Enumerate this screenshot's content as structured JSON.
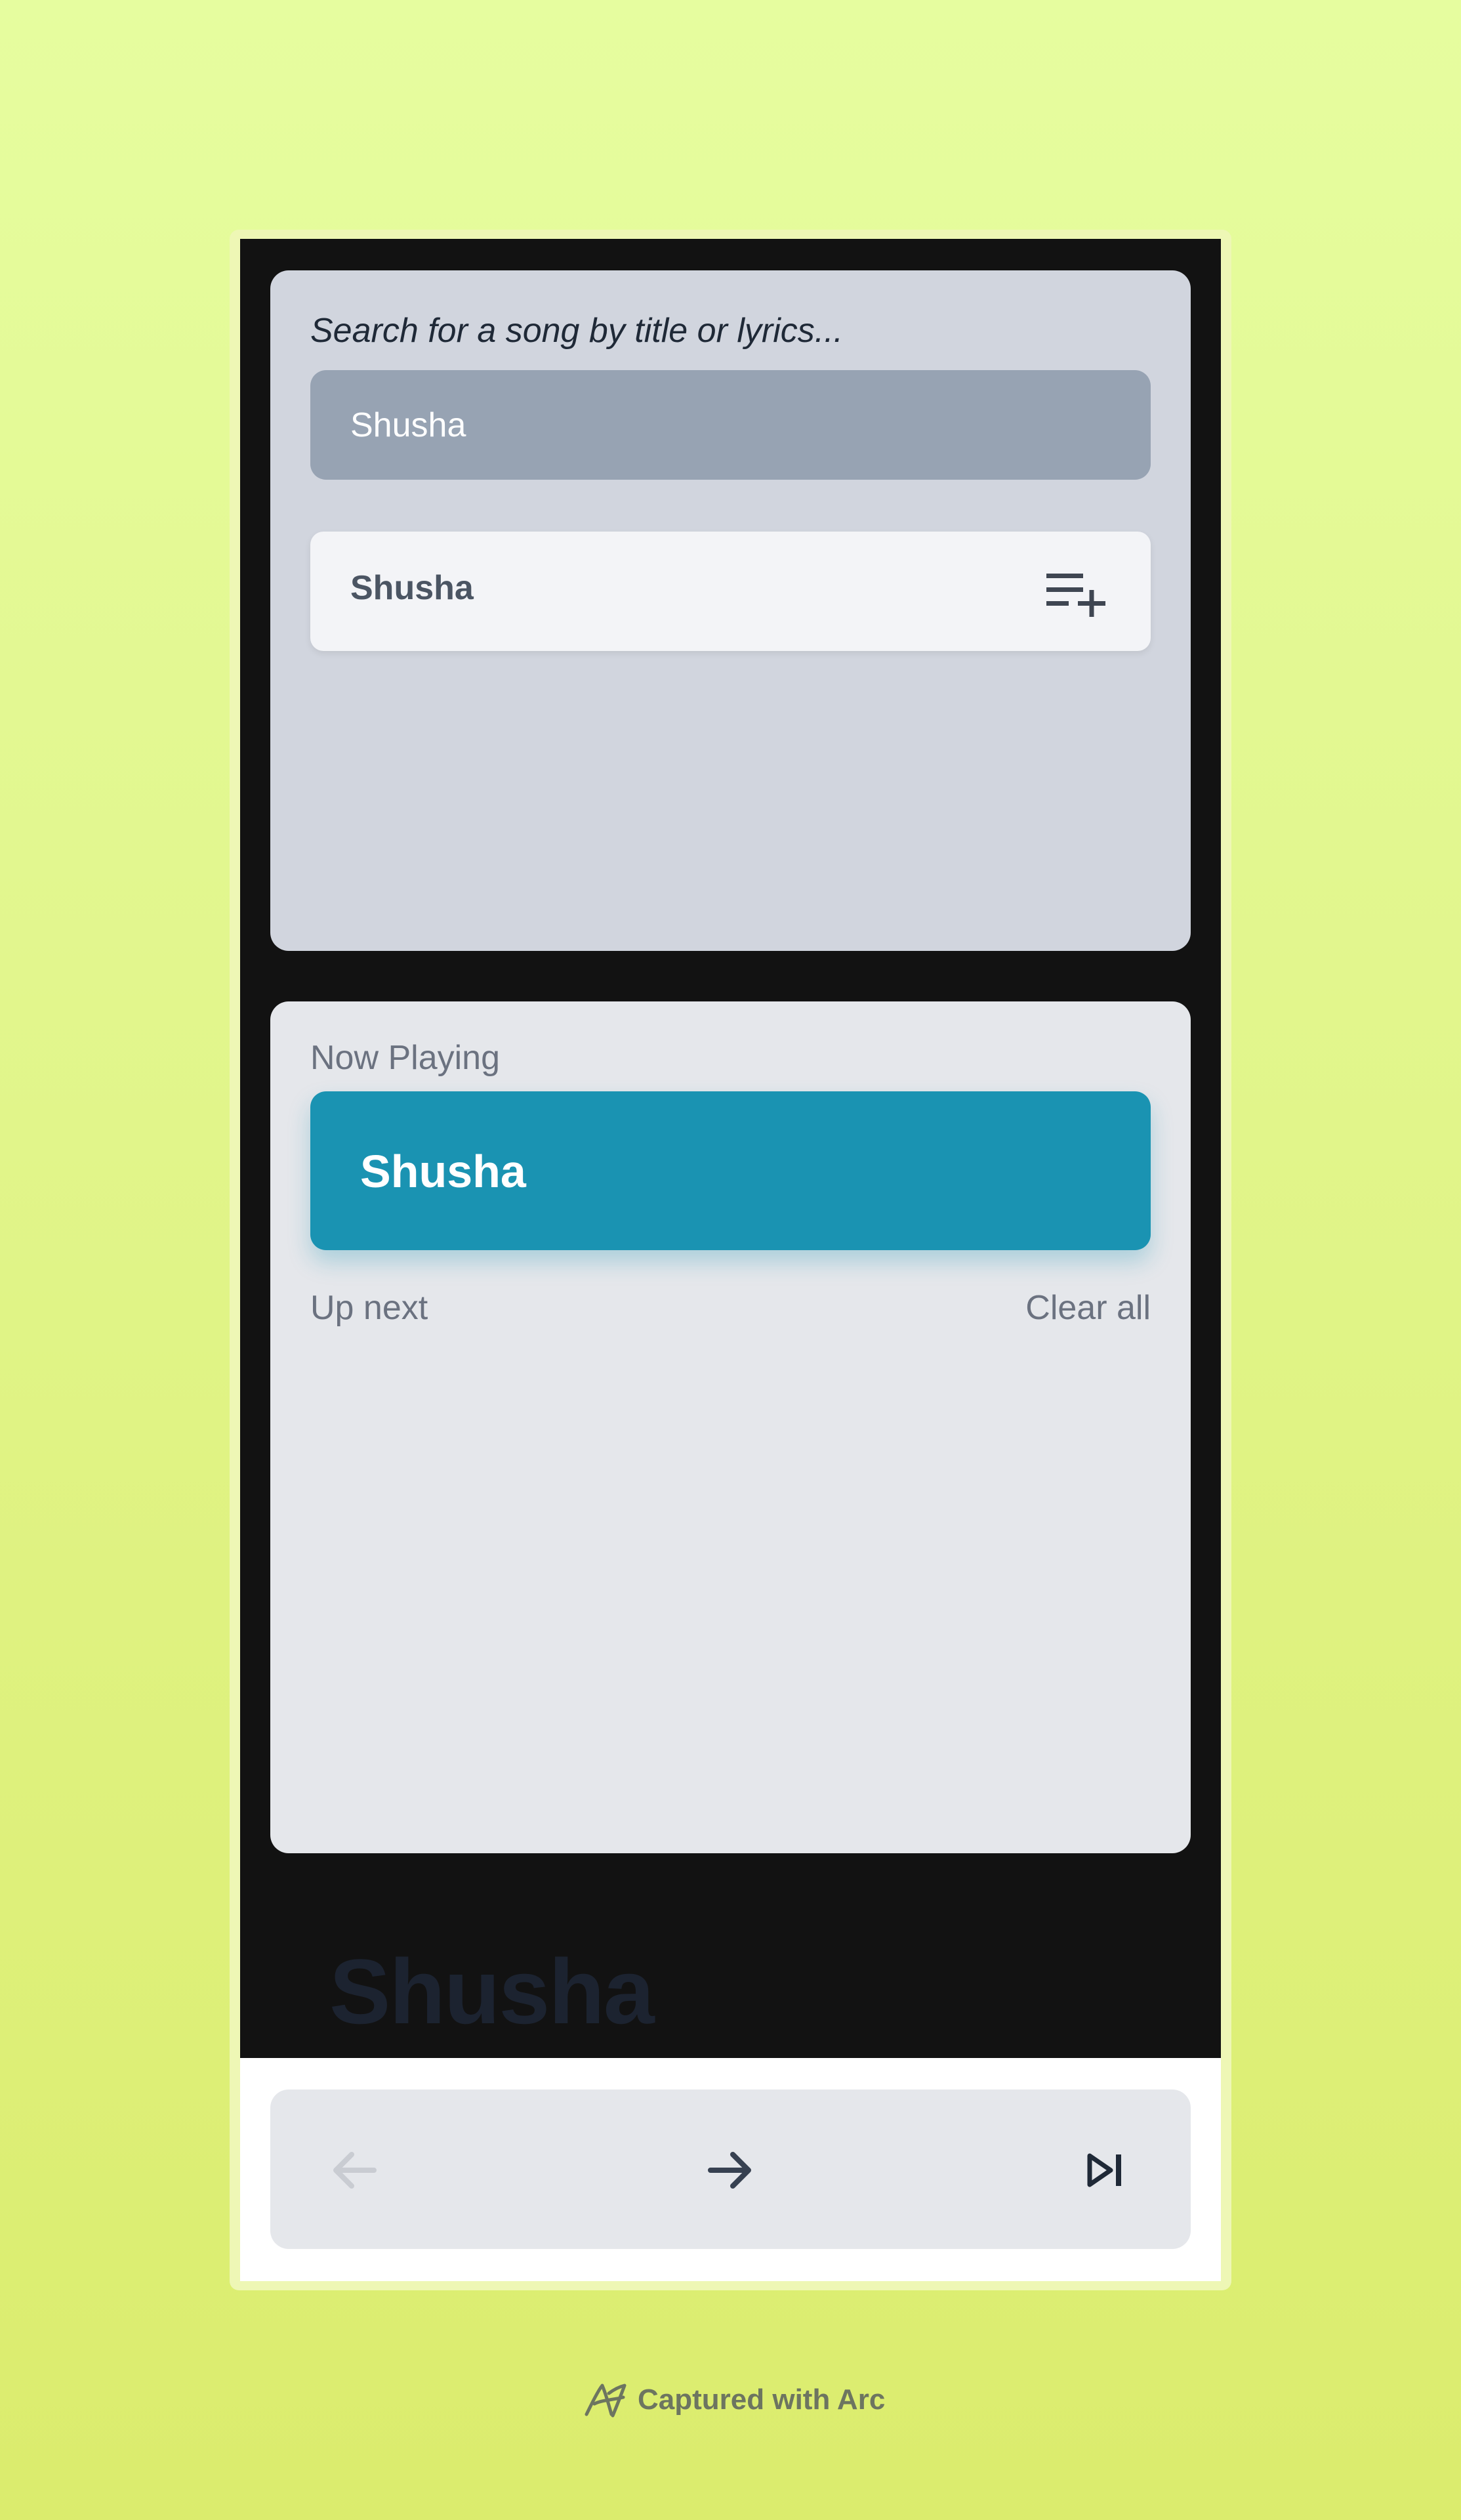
{
  "search": {
    "label": "Search for a song by title or lyrics...",
    "value": "Shusha",
    "results": [
      {
        "title": "Shusha",
        "icon": "playlist-add-icon"
      }
    ]
  },
  "queue": {
    "now_playing_label": "Now Playing",
    "now_playing_title": "Shusha",
    "up_next_label": "Up next",
    "clear_all_label": "Clear all"
  },
  "backdrop_title": "Shusha",
  "controls": {
    "previous_icon": "arrow-left-icon",
    "next_icon": "arrow-right-icon",
    "skip_icon": "skip-next-icon",
    "previous_enabled": false
  },
  "footer": {
    "text": "Captured with Arc",
    "icon": "arc-logo-icon"
  },
  "colors": {
    "accent": "#1a93b2",
    "dark_background": "#121212",
    "search_panel": "#d1d5de",
    "queue_panel": "#e5e7eb"
  }
}
